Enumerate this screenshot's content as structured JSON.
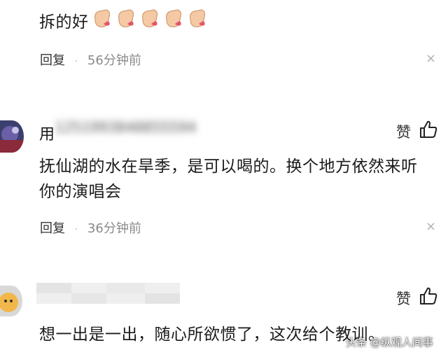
{
  "comments": [
    {
      "text": "拆的好",
      "emojis": [
        "clap-emoji",
        "clap-emoji",
        "clap-emoji",
        "clap-emoji",
        "clap-emoji"
      ],
      "reply_label": "回复",
      "separator": "·",
      "time": "56分钟前",
      "close_icon": "×"
    },
    {
      "username_partial": "用",
      "username_blurred": "1251993840855594",
      "like_label": "赞",
      "like_icon": "thumbs-up-icon",
      "text_line1": "抚仙湖的水在旱季，是可以喝的。换个地方依然来听",
      "text_line2": "你的演唱会",
      "reply_label": "回复",
      "separator": "·",
      "time": "36分钟前",
      "close_icon": "×"
    },
    {
      "like_label": "赞",
      "like_icon": "thumbs-up-icon",
      "text": "想一出是一出，随心所欲惯了，这次给个教训。"
    }
  ],
  "watermark": {
    "source": "头条",
    "handle": "@纵观人间事"
  }
}
